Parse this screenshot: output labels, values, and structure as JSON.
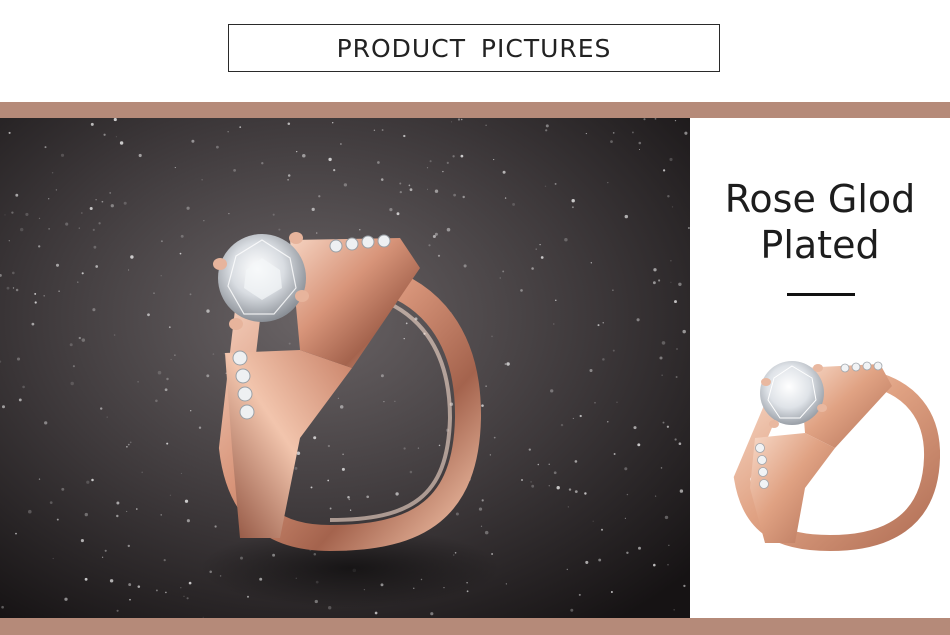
{
  "header": {
    "title": "PRODUCT  PICTURES"
  },
  "side": {
    "title_line1": "Rose Glod",
    "title_line2": "Plated"
  },
  "colors": {
    "band": "#b58a79",
    "rose_gold": "#e3a98f",
    "background_dark": "#2e2a2b",
    "text": "#1d1d1d"
  },
  "images": {
    "main": "rose-gold-solitaire-ring-photo",
    "small": "rose-gold-ring-product-thumbnail"
  }
}
